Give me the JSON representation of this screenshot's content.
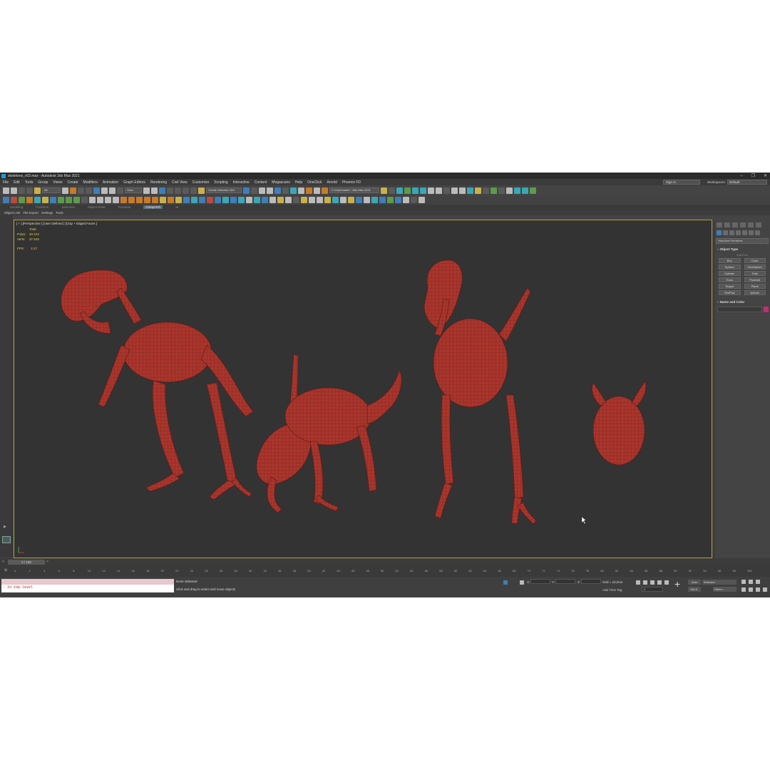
{
  "window": {
    "title": "skeletons_v03.max - Autodesk 3ds Max 2021",
    "controls": [
      "–",
      "❐",
      "✕"
    ]
  },
  "menu": [
    "File",
    "Edit",
    "Tools",
    "Group",
    "Views",
    "Create",
    "Modifiers",
    "Animation",
    "Graph Editors",
    "Rendering",
    "Civil View",
    "Customize",
    "Scripting",
    "Interactive",
    "Content",
    "Megascans",
    "Help",
    "OneClick",
    "Arnold",
    "Phoenix FD"
  ],
  "signin": "Sign In",
  "workspaces": {
    "label": "Workspaces:",
    "value": "Default"
  },
  "toolbar": {
    "filter": "All",
    "view": "View",
    "selection_set": "Create Selection Set",
    "path": "C:\\Users\\admi...\\3ds Max 2021"
  },
  "ribbon_tabs": [
    "Modeling",
    "Freeform",
    "Selection",
    "Object Paint",
    "Populate",
    "Dataprinth"
  ],
  "ribbon_active": "Dataprinth",
  "scene_explorer": [
    "Object Link",
    "File Export",
    "Settings",
    "Tools"
  ],
  "viewport": {
    "label": "[ + ] [Perspective ] [User Defined ] [Clay + Edged Faces ]",
    "stats": {
      "total_label": "Total",
      "polys_label": "Polys:",
      "polys": "40 413",
      "verts_label": "Verts:",
      "verts": "37 633"
    },
    "fps_label": "FPS:",
    "fps": "2,17",
    "model_color": "#a9352c",
    "background": "#333333"
  },
  "command_panel": {
    "dropdown": "Standard Primitives",
    "object_type_header": "Object Type",
    "autogrid": "AutoGrid",
    "primitives": [
      "Box",
      "Cone",
      "Sphere",
      "GeoSphere",
      "Cylinder",
      "Tube",
      "Torus",
      "Pyramid",
      "Teapot",
      "Plane",
      "TextPlus",
      "fyHose"
    ],
    "name_color_header": "Name and Color"
  },
  "timeline": {
    "slider": "0 / 100",
    "ticks": [
      "0",
      "2",
      "4",
      "6",
      "8",
      "10",
      "12",
      "14",
      "16",
      "18",
      "20",
      "22",
      "24",
      "26",
      "28",
      "30",
      "32",
      "34",
      "36",
      "38",
      "40",
      "42",
      "44",
      "46",
      "48",
      "50",
      "52",
      "54",
      "56",
      "58",
      "60",
      "62",
      "64",
      "66",
      "68",
      "70",
      "72",
      "74",
      "76",
      "78",
      "80",
      "82",
      "84",
      "86",
      "88",
      "90",
      "92",
      "94",
      "96",
      "98",
      "100"
    ]
  },
  "status": {
    "maxscript": "- In top-level",
    "selected": "None Selected",
    "hint": "Click and drag to select and move objects",
    "x_label": "X:",
    "y_label": "Y:",
    "z_label": "Z:",
    "grid": "Grid = 10,0cm",
    "add_time_tag": "Add Time Tag",
    "auto": "Auto",
    "set_key": "Set K.",
    "selected_dropdown": "Selected",
    "filters": "Filters...",
    "frame": "0"
  }
}
